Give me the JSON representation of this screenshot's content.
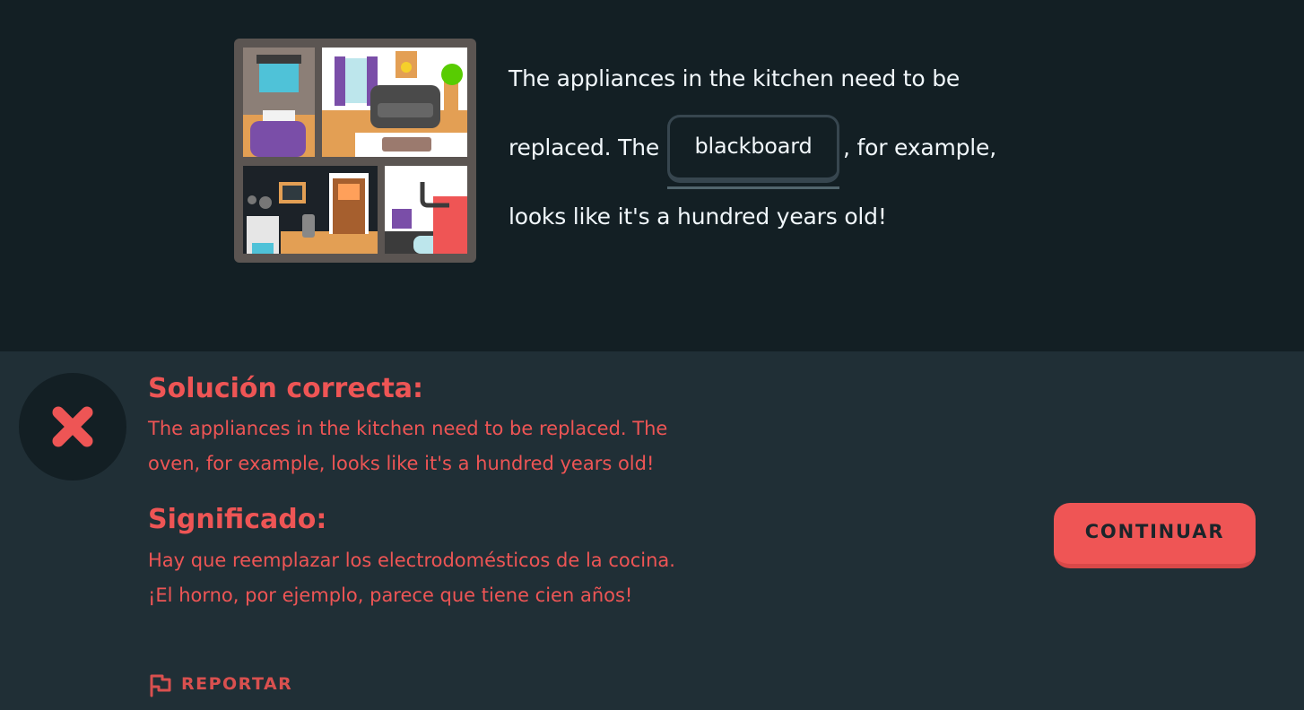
{
  "prompt": {
    "line1": "The appliances in the kitchen need to be",
    "line2_before": "replaced. The",
    "selected_answer": "blackboard",
    "line2_after": ", for example,",
    "line3": "looks like it's a hundred years old!"
  },
  "feedback": {
    "solution_heading": "Solución correcta:",
    "solution_text": "The appliances in the kitchen need to be replaced. The oven, for example, looks like it's a hundred years old!",
    "meaning_heading": "Significado:",
    "meaning_text": "Hay que reemplazar los electrodomésticos de la cocina. ¡El horno, por ejemplo, parece que tiene cien años!",
    "report_label": "REPORTAR"
  },
  "buttons": {
    "continue_label": "CONTINUAR"
  },
  "icons": {
    "result": "close-icon",
    "report": "flag-icon",
    "illustration": "house-illustration"
  },
  "colors": {
    "top_background": "#131f24",
    "bottom_background": "#202f36",
    "error": "#ee5555",
    "text_light": "#f1f7fb"
  }
}
